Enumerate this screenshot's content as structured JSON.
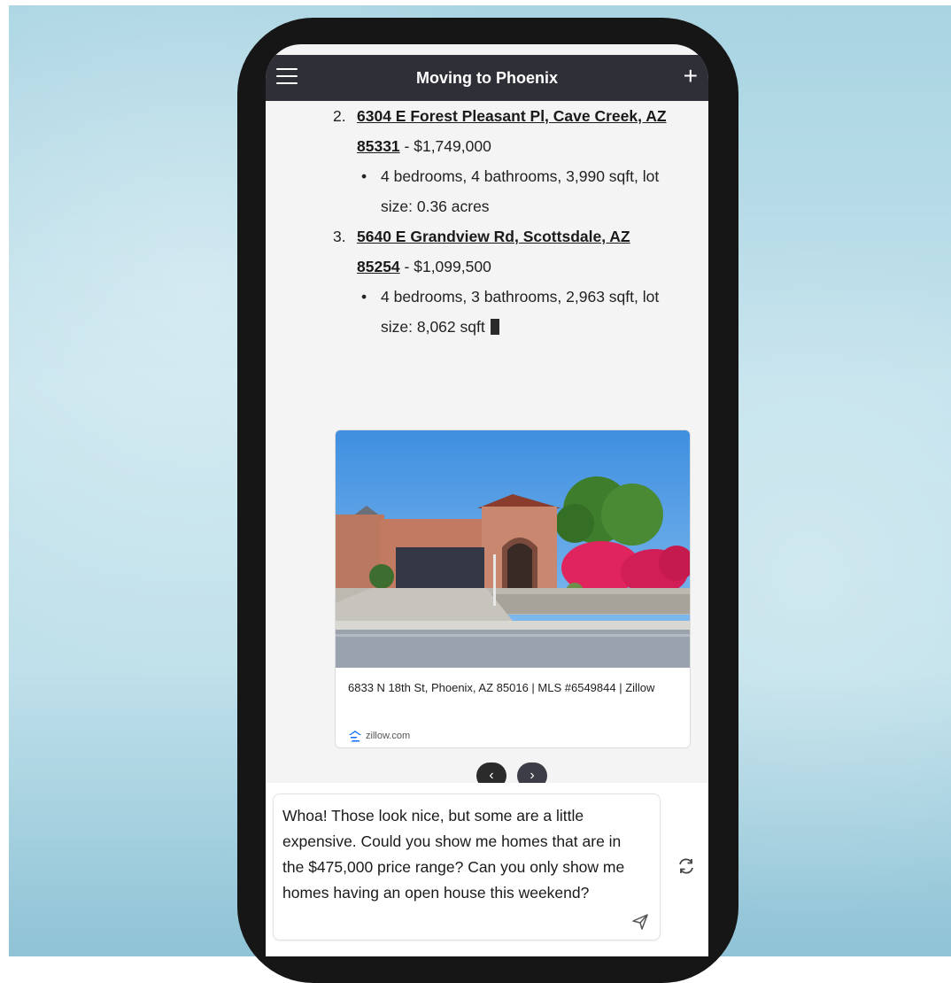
{
  "header": {
    "title": "Moving to Phoenix",
    "menu_icon": "hamburger-menu-icon",
    "new_chat_icon": "plus-icon"
  },
  "listings": [
    {
      "number": "2.",
      "address_line1": "6304 E Forest Pleasant Pl, Cave Creek, AZ",
      "address_line2": "85331",
      "price": " - $1,749,000",
      "details_line1": "4 bedrooms, 4 bathrooms, 3,990 sqft, lot",
      "details_line2": "size: 0.36 acres"
    },
    {
      "number": "3.",
      "address_line1": "5640 E Grandview Rd, Scottsdale, AZ",
      "address_line2": "85254",
      "price": " - $1,099,500",
      "details_line1": "4 bedrooms, 3 bathrooms, 2,963 sqft, lot",
      "details_line2": "size: 8,062 sqft"
    }
  ],
  "bullet_char": "•",
  "card": {
    "caption": "6833 N 18th St, Phoenix, AZ 85016 | MLS #6549844 | Zillow",
    "source": "zillow.com",
    "source_icon": "zillow-logo-icon"
  },
  "carousel": {
    "prev_label": "‹",
    "next_label": "›"
  },
  "composer": {
    "text": "Whoa! Those look nice, but some are a little expensive. Could you show me homes that are in the $475,000 price range? Can you only show me homes having an open house this weekend?",
    "send_icon": "send-icon",
    "regenerate_icon": "refresh-icon"
  },
  "colors": {
    "header_bg": "#2f2f37",
    "screen_bg": "#f4f4f4",
    "phone_frame": "#161616",
    "backdrop": "#b7dce8"
  }
}
